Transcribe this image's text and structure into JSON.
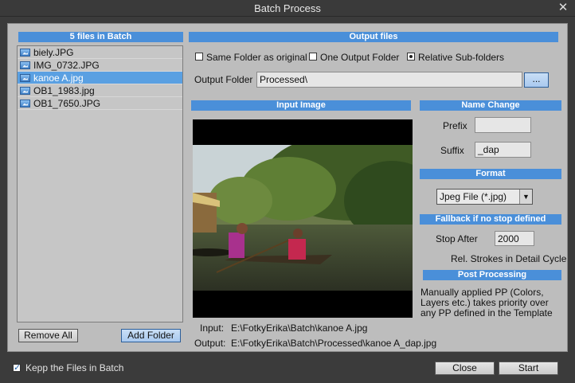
{
  "window": {
    "title": "Batch Process",
    "close_glyph": "✕"
  },
  "batch": {
    "header": "5 files in Batch",
    "files": [
      "biely.JPG",
      "IMG_0732.JPG",
      "kanoe A.jpg",
      "OB1_1983.jpg",
      "OB1_7650.JPG"
    ],
    "selected_index": 2,
    "remove_all": "Remove All",
    "add_folder": "Add Folder"
  },
  "output": {
    "header": "Output files",
    "opt_same_folder": "Same Folder as original",
    "opt_one_folder": "One Output Folder",
    "opt_relative": "Relative Sub-folders",
    "folder_label": "Output Folder",
    "folder_value": "Processed\\",
    "browse": "..."
  },
  "input_image": {
    "header": "Input Image",
    "input_label": "Input:",
    "input_path": "E:\\FotkyErika\\Batch\\kanoe A.jpg",
    "output_label": "Output:",
    "output_path": "E:\\FotkyErika\\Batch\\Processed\\kanoe A_dap.jpg"
  },
  "name_change": {
    "header": "Name Change",
    "prefix_label": "Prefix",
    "prefix_value": "",
    "suffix_label": "Suffix",
    "suffix_value": "_dap"
  },
  "format": {
    "header": "Format",
    "selected": "Jpeg File (*.jpg)"
  },
  "fallback": {
    "header": "Fallback if no stop defined",
    "stop_after_label": "Stop After",
    "stop_after_value": "2000",
    "rel_strokes": "Rel. Strokes in Detail Cycle"
  },
  "post_processing": {
    "header": "Post Processing",
    "text": "Manually applied PP (Colors, Layers etc.) takes priority over any PP defined in the Template"
  },
  "footer": {
    "keep_files": "Kepp the Files in Batch",
    "keep_checked": true,
    "close": "Close",
    "start": "Start"
  },
  "colors": {
    "accent": "#4a8fd9",
    "selection": "#5aa0e2",
    "panel": "#bdbdbd"
  }
}
